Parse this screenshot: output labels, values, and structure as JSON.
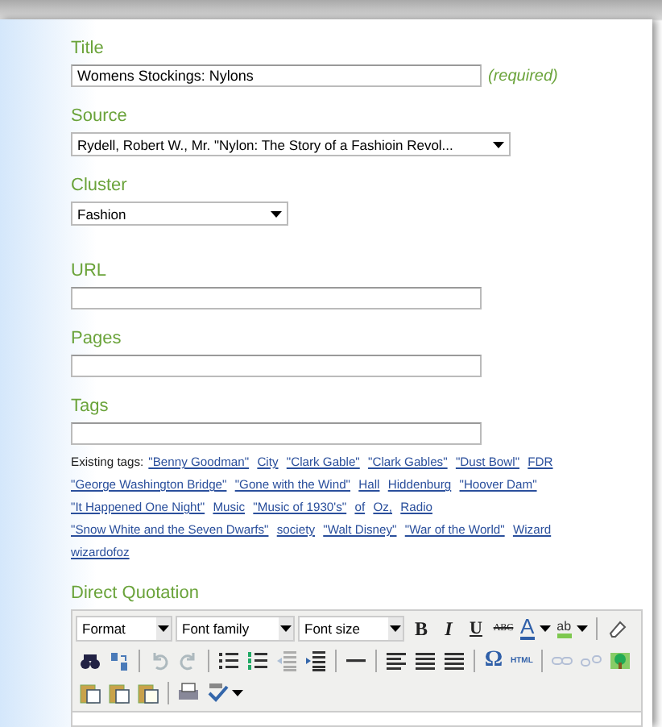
{
  "fields": [
    {
      "kind": "text",
      "label": "Title",
      "value": "Womens Stockings: Nylons",
      "note": "(required)"
    },
    {
      "kind": "select",
      "label": "Source",
      "value": "Rydell, Robert W., Mr. \"Nylon: The Story of a Fashioin Revol..."
    },
    {
      "kind": "select",
      "label": "Cluster",
      "value": "Fashion"
    },
    {
      "kind": "text",
      "label": "URL"
    },
    {
      "kind": "text",
      "label": "Pages"
    },
    {
      "kind": "text",
      "label": "Tags"
    }
  ],
  "existing_tags": {
    "label": "Existing tags:",
    "tags": [
      "\"Benny Goodman\"",
      "City",
      "\"Clark Gable\"",
      "\"Clark Gables\"",
      "\"Dust Bowl\"",
      "FDR",
      "\"George Washington Bridge\"",
      "\"Gone with the Wind\"",
      "Hall",
      "Hiddenburg",
      "\"Hoover Dam\"",
      "\"It Happened One Night\"",
      "Music",
      "\"Music of 1930's\"",
      "of",
      "Oz,",
      "Radio",
      "\"Snow White and the Seven Dwarfs\"",
      "society",
      "\"Walt Disney\"",
      "\"War of the World\"",
      "Wizard",
      "wizardofoz"
    ]
  },
  "editor": {
    "label": "Direct Quotation",
    "toolbar": [
      [
        {
          "kind": "select",
          "label": "Format"
        },
        {
          "kind": "select",
          "label": "Font family"
        },
        {
          "kind": "select",
          "label": "Font size"
        },
        {
          "kind": "bold",
          "label": "B"
        },
        {
          "kind": "italic",
          "label": "I"
        },
        {
          "kind": "underline",
          "label": "U"
        },
        {
          "kind": "strike",
          "label": "ABC"
        },
        {
          "kind": "forecolor",
          "label": "A"
        },
        {
          "kind": "backcolor",
          "label": "ab"
        },
        {
          "kind": "sep"
        },
        {
          "kind": "eraser"
        }
      ],
      [
        {
          "kind": "find"
        },
        {
          "kind": "replace"
        },
        {
          "kind": "sep"
        },
        {
          "kind": "undo",
          "disabled": true
        },
        {
          "kind": "redo",
          "disabled": true
        },
        {
          "kind": "sep"
        },
        {
          "kind": "bullets"
        },
        {
          "kind": "numbers"
        },
        {
          "kind": "outdent",
          "disabled": true
        },
        {
          "kind": "indent"
        },
        {
          "kind": "sep"
        },
        {
          "kind": "hr"
        },
        {
          "kind": "sep"
        },
        {
          "kind": "left"
        },
        {
          "kind": "center"
        },
        {
          "kind": "right"
        },
        {
          "kind": "sep"
        },
        {
          "kind": "charmap",
          "label": "Ω"
        },
        {
          "kind": "html",
          "label": "HTML"
        },
        {
          "kind": "sep"
        },
        {
          "kind": "link",
          "disabled": true
        },
        {
          "kind": "unlink",
          "disabled": true
        },
        {
          "kind": "image"
        }
      ],
      [
        {
          "kind": "pastetext"
        },
        {
          "kind": "pasteword"
        },
        {
          "kind": "paste"
        },
        {
          "kind": "sep"
        },
        {
          "kind": "print"
        },
        {
          "kind": "spellcheck"
        }
      ]
    ]
  }
}
